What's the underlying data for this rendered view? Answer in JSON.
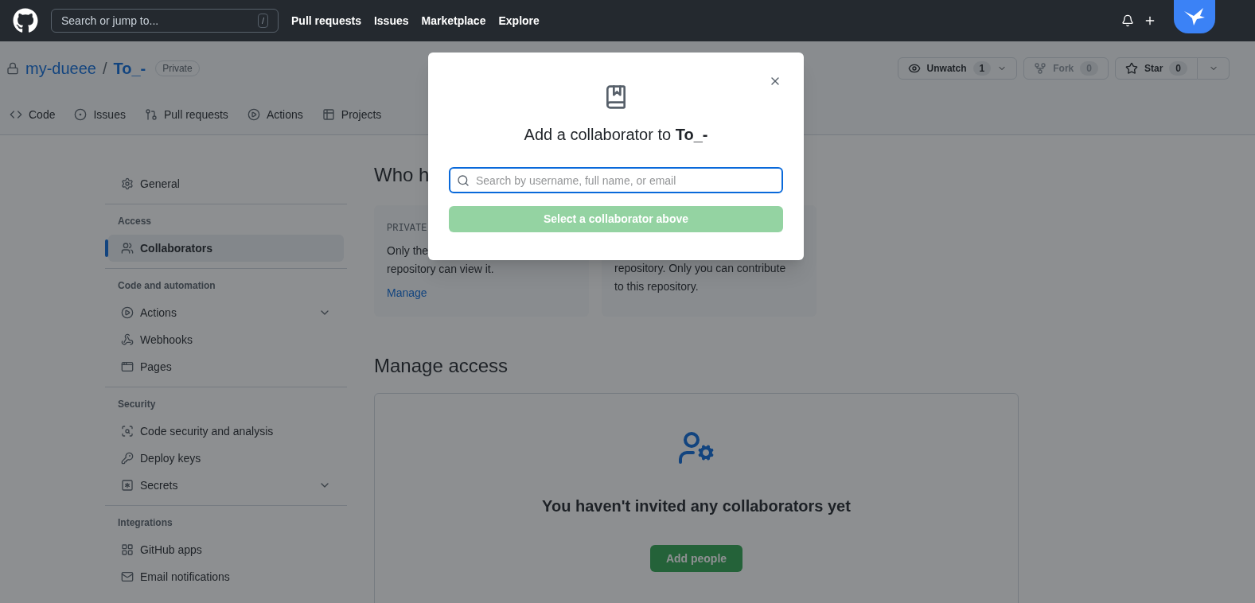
{
  "header": {
    "search_placeholder": "Search or jump to...",
    "search_key": "/",
    "nav": [
      "Pull requests",
      "Issues",
      "Marketplace",
      "Explore"
    ]
  },
  "repo": {
    "owner": "my-dueee",
    "separator": "/",
    "name": "To_-",
    "visibility": "Private",
    "actions": [
      {
        "kind": "watch",
        "label": "Unwatch",
        "count": "1",
        "menu": true
      },
      {
        "kind": "fork",
        "label": "Fork",
        "count": "0",
        "menu": false
      },
      {
        "kind": "star",
        "label": "Star",
        "count": "0",
        "menu": true
      }
    ]
  },
  "tabs": [
    {
      "kind": "code",
      "label": "Code"
    },
    {
      "kind": "issues",
      "label": "Issues"
    },
    {
      "kind": "pulls",
      "label": "Pull requests"
    },
    {
      "kind": "actions",
      "label": "Actions"
    },
    {
      "kind": "projects",
      "label": "Projects"
    }
  ],
  "sidebar": [
    {
      "items": [
        {
          "kind": "general",
          "label": "General",
          "selected": false,
          "expandable": false
        }
      ]
    },
    {
      "heading": "Access",
      "items": [
        {
          "kind": "collaborators",
          "label": "Collaborators",
          "selected": true,
          "expandable": false
        }
      ]
    },
    {
      "heading": "Code and automation",
      "items": [
        {
          "kind": "actions",
          "label": "Actions",
          "selected": false,
          "expandable": true
        },
        {
          "kind": "webhooks",
          "label": "Webhooks",
          "selected": false,
          "expandable": false
        },
        {
          "kind": "pages",
          "label": "Pages",
          "selected": false,
          "expandable": false
        }
      ]
    },
    {
      "heading": "Security",
      "items": [
        {
          "kind": "security",
          "label": "Code security and analysis",
          "selected": false,
          "expandable": false
        },
        {
          "kind": "keys",
          "label": "Deploy keys",
          "selected": false,
          "expandable": false
        },
        {
          "kind": "secrets",
          "label": "Secrets",
          "selected": false,
          "expandable": true
        }
      ]
    },
    {
      "heading": "Integrations",
      "items": [
        {
          "kind": "apps",
          "label": "GitHub apps",
          "selected": false,
          "expandable": false
        },
        {
          "kind": "email",
          "label": "Email notifications",
          "selected": false,
          "expandable": false
        }
      ]
    }
  ],
  "access": {
    "heading": "Who h",
    "cards": [
      {
        "label": "PRIVATE",
        "lines": [
          "Only the",
          "repository can view it."
        ],
        "link": "Manage"
      },
      {
        "lines": [
          "repository. Only you can contribute",
          "to this repository."
        ]
      }
    ]
  },
  "manage": {
    "heading": "Manage access",
    "empty_text": "You haven't invited any collaborators yet",
    "button": "Add people"
  },
  "modal": {
    "title": "Add a collaborator to ",
    "repo": "To_-",
    "placeholder": "Search by username, full name, or email",
    "button": "Select a collaborator above",
    "button_disabled": true
  }
}
